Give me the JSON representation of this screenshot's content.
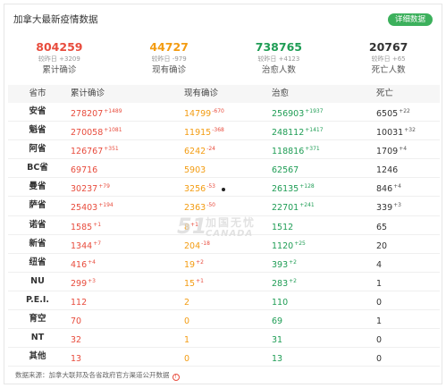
{
  "header": {
    "title": "加拿大最新疫情数据",
    "detail_label": "详细数据"
  },
  "colors": {
    "confirmed": "#e84c3d",
    "current": "#f39c12",
    "cured": "#1f9d55",
    "dead": "#333333",
    "button": "#3cb05c"
  },
  "summary": [
    {
      "value": "804259",
      "delta_prefix": "较昨日",
      "delta": "+3209",
      "label": "累计确诊",
      "color": "#e84c3d"
    },
    {
      "value": "44727",
      "delta_prefix": "较昨日",
      "delta": "-979",
      "label": "现有确诊",
      "color": "#f39c12"
    },
    {
      "value": "738765",
      "delta_prefix": "较昨日",
      "delta": "+4123",
      "label": "治愈人数",
      "color": "#1f9d55"
    },
    {
      "value": "20767",
      "delta_prefix": "较昨日",
      "delta": "+65",
      "label": "死亡人数",
      "color": "#333333"
    }
  ],
  "table": {
    "headers": [
      "省市",
      "累计确诊",
      "现有确诊",
      "治愈",
      "死亡"
    ],
    "rows": [
      {
        "name": "安省",
        "confirmed": "278207",
        "confirmed_d": "+1489",
        "current": "14799",
        "current_d": "-670",
        "cured": "256903",
        "cured_d": "+1937",
        "dead": "6505",
        "dead_d": "+22"
      },
      {
        "name": "魁省",
        "confirmed": "270058",
        "confirmed_d": "+1081",
        "current": "11915",
        "current_d": "-368",
        "cured": "248112",
        "cured_d": "+1417",
        "dead": "10031",
        "dead_d": "+32"
      },
      {
        "name": "阿省",
        "confirmed": "126767",
        "confirmed_d": "+351",
        "current": "6242",
        "current_d": "-24",
        "cured": "118816",
        "cured_d": "+371",
        "dead": "1709",
        "dead_d": "+4"
      },
      {
        "name": "BC省",
        "confirmed": "69716",
        "confirmed_d": "",
        "current": "5903",
        "current_d": "",
        "cured": "62567",
        "cured_d": "",
        "dead": "1246",
        "dead_d": ""
      },
      {
        "name": "曼省",
        "confirmed": "30237",
        "confirmed_d": "+79",
        "current": "3256",
        "current_d": "-53",
        "cured": "26135",
        "cured_d": "+128",
        "dead": "846",
        "dead_d": "+4"
      },
      {
        "name": "萨省",
        "confirmed": "25403",
        "confirmed_d": "+194",
        "current": "2363",
        "current_d": "-50",
        "cured": "22701",
        "cured_d": "+241",
        "dead": "339",
        "dead_d": "+3"
      },
      {
        "name": "诺省",
        "confirmed": "1585",
        "confirmed_d": "+1",
        "current": "8",
        "current_d": "+1",
        "cured": "1512",
        "cured_d": "",
        "dead": "65",
        "dead_d": ""
      },
      {
        "name": "新省",
        "confirmed": "1344",
        "confirmed_d": "+7",
        "current": "204",
        "current_d": "-18",
        "cured": "1120",
        "cured_d": "+25",
        "dead": "20",
        "dead_d": ""
      },
      {
        "name": "纽省",
        "confirmed": "416",
        "confirmed_d": "+4",
        "current": "19",
        "current_d": "+2",
        "cured": "393",
        "cured_d": "+2",
        "dead": "4",
        "dead_d": ""
      },
      {
        "name": "NU",
        "confirmed": "299",
        "confirmed_d": "+3",
        "current": "15",
        "current_d": "+1",
        "cured": "283",
        "cured_d": "+2",
        "dead": "1",
        "dead_d": ""
      },
      {
        "name": "P.E.I.",
        "confirmed": "112",
        "confirmed_d": "",
        "current": "2",
        "current_d": "",
        "cured": "110",
        "cured_d": "",
        "dead": "0",
        "dead_d": ""
      },
      {
        "name": "育空",
        "confirmed": "70",
        "confirmed_d": "",
        "current": "0",
        "current_d": "",
        "cured": "69",
        "cured_d": "",
        "dead": "1",
        "dead_d": ""
      },
      {
        "name": "NT",
        "confirmed": "32",
        "confirmed_d": "",
        "current": "1",
        "current_d": "",
        "cured": "31",
        "cured_d": "",
        "dead": "0",
        "dead_d": ""
      },
      {
        "name": "其他",
        "confirmed": "13",
        "confirmed_d": "",
        "current": "0",
        "current_d": "",
        "cured": "13",
        "cured_d": "",
        "dead": "0",
        "dead_d": ""
      }
    ]
  },
  "watermark": {
    "logo": "51",
    "cn": "加国无忧",
    "en": "CANADA"
  },
  "footer": {
    "source": "数据来源：加拿大联邦及各省政府官方渠道公开数据"
  }
}
